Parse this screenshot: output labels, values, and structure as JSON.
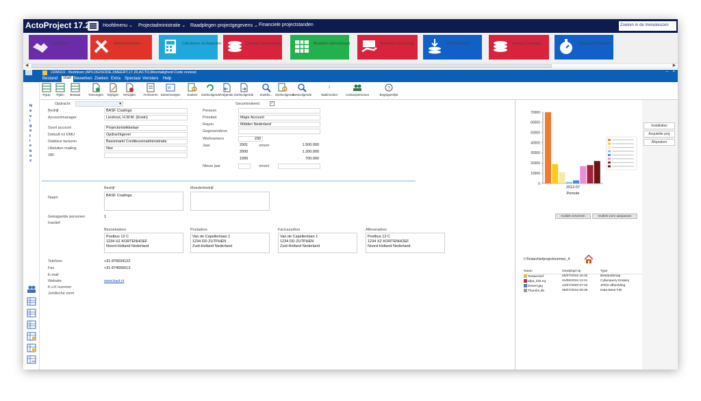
{
  "app": {
    "title": "ActoProject 17.20",
    "menu": [
      "Hoofdmenu",
      "Projectadministratie",
      "Raadplegen projectgegevens",
      "Financiele projectstanden"
    ],
    "menu_search": "Zoeken in de menukeuzen"
  },
  "tiles": [
    {
      "label": "Favorieten",
      "color": "#6a2ca8",
      "icon": "handshake-icon"
    },
    {
      "label": "Middelenbeheer",
      "color": "#e2332a",
      "icon": "tools-icon"
    },
    {
      "label": "Calculeren en begroten",
      "color": "#1fa8dc",
      "icon": "calculator-icon"
    },
    {
      "label": "Inkopen (decentraal)",
      "color": "#d9223b",
      "icon": "coins-icon"
    },
    {
      "label": "Bestellen (decentraal)",
      "color": "#22b14c",
      "icon": "spreadsheet-icon"
    },
    {
      "label": "Bestellen (Centraal)",
      "color": "#d9223b",
      "icon": "cash-hand-icon"
    },
    {
      "label": "Offertebeheer",
      "color": "#1060c8",
      "icon": "download-coins-icon"
    },
    {
      "label": "Inkoop (Centraal)",
      "color": "#d9223b",
      "icon": "coins-icon"
    },
    {
      "label": "Projectadministratie",
      "color": "#1060c8",
      "icon": "stopwatch-icon"
    }
  ],
  "window": {
    "title": "CRM110 - Bedrijven (APLOGISODE,XMEERT,17.20,ACTO,Meertaligheid Code review)",
    "tabs": [
      "Bestand",
      "Start",
      "Bewerken",
      "Zoeken",
      "Extra",
      "Speciaal",
      "Vensters",
      "Help"
    ],
    "active_tab": "Start"
  },
  "ribbon": [
    "PgUp",
    "PgDn",
    "Bewaar",
    "Toevoegen",
    "Wijzigen",
    "Verwijder",
    "Archiveren",
    "Samenvoegen",
    "Zoeken",
    "Zoeken",
    "Zoekvolgende",
    "Volgende",
    "Zoekvolgende",
    "Zoekbo...",
    "Zoekbo...",
    "Zoekvolgende",
    "Taakmonitor",
    "Contactpersonen",
    "Begrippenlijst"
  ],
  "ribbon_short": {
    "b1": "PgUp",
    "b2": "PgDn",
    "b3": "Bewaar",
    "b4": "Toevoegen",
    "b5": "Wijzigen",
    "b6": "Verwijder",
    "b7": "Archiveren",
    "b8": "Samenvoegen",
    "b9": "Zoeken",
    "b10": "Zoekvolgende",
    "b11": "Volgende",
    "b12": "Zoekvolgende",
    "b13": "Zoekbo...",
    "b14": "Zoekvolgende",
    "b15": "Zoekvolgende",
    "b16": "Taakmonitor",
    "b17": "Contactpersonen",
    "b18": "Begrippenlijst",
    "taak_count": "1"
  },
  "navigator": "Navigatiebox",
  "form": {
    "opdracht_label": "Opdracht",
    "gecontroleerd_label": "Gecontroleerd",
    "bedrijf_label": "Bedrijf",
    "bedrijf": "BASF Coatings",
    "accountmanager_label": "Accountmanager",
    "accountmanager": "Lieshout, H.W.M. (Erwin)",
    "soort_account_label": "Soort account",
    "soort_account": "Projectontwikkelaar",
    "default_rol_label": "Default rol DMU",
    "default_rol": "Opdrachtgever",
    "debiteur_label": "Debiteur facturen",
    "debiteur": "Basismarkt Crediteurenadministratie",
    "uitsluiten_label": "Uitsluiten mailing",
    "uitsluiten": "Nee",
    "sbi_label": "SBI",
    "persoon_label": "Persoon",
    "prioriteit_label": "Prioriteit",
    "prioriteit": "Major Account",
    "rayon_label": "Rayon",
    "rayon": "Midden Nederland",
    "gegevensbron_label": "Gegevensbron",
    "werknemers_label": "Werknemers",
    "werknemers": "230",
    "jaar_label": "Jaar",
    "omzet_label": "omzet",
    "jaren": [
      {
        "jaar": "2001",
        "omzet": "1.500.000"
      },
      {
        "jaar": "2000",
        "omzet": "1.200.000"
      },
      {
        "jaar": "1999",
        "omzet": "700.000"
      }
    ],
    "nieuw_jaar_label": "Nieuw jaar",
    "naam_label": "Naam",
    "bedrijf_header": "Bedrijf",
    "naam": "BASF Coatings",
    "moederbedrijf_header": "Moederbedrijf",
    "gekoppelde_label": "Gekoppelde personen",
    "gekoppelde": "1",
    "inactief_label": "Inactief",
    "addresses": [
      {
        "header": "Bezoekadres",
        "text": "Postbus 12 C\n1234 XZ KORTENHOEF\nNoord-Holland Nederland"
      },
      {
        "header": "Postadres",
        "text": "Van de Capellenlaan 1\n1234 DD ZUTPHEN\nZuid-Holland Nederland"
      },
      {
        "header": "Factuuradres",
        "text": "Van de Capellenlaan 1\n1234 DD ZUTPHEN\nZuid-Holland Nederland"
      },
      {
        "header": "Afleveradres",
        "text": "Postbus 12 C\n1234 XZ KORTENHOEF\nNoord-Holland Nederland"
      }
    ],
    "telefoon_label": "Telefoon",
    "telefoon": "+31 876694122",
    "fax_label": "Fax",
    "fax": "+31 874556613",
    "email_label": "E-mail",
    "website_label": "Website",
    "website": "www.basf.nl",
    "kvk_label": "K.v.K nummer",
    "juridische_label": "Juridische vorm"
  },
  "chart_data": {
    "type": "bar",
    "categories": [
      "2012-07"
    ],
    "xlabel": "Periode",
    "ylim": [
      0,
      70000
    ],
    "yticks": [
      0,
      10000,
      20000,
      30000,
      40000,
      50000,
      60000,
      70000
    ],
    "series": [
      {
        "values": [
          70000
        ],
        "color": "#f07a2e"
      },
      {
        "values": [
          19000
        ],
        "color": "#f5cc1e"
      },
      {
        "values": [
          11000
        ],
        "color": "#f5e9a8"
      },
      {
        "values": [
          1500
        ],
        "color": "#7fc7e6"
      },
      {
        "values": [
          3000
        ],
        "color": "#4a88d8"
      },
      {
        "values": [
          17000
        ],
        "color": "#e98ed9"
      },
      {
        "values": [
          18000
        ],
        "color": "#a0233a"
      },
      {
        "values": [
          22000
        ],
        "color": "#6b1414"
      }
    ],
    "legend": "right"
  },
  "chart_buttons": {
    "refresh": "Grafiek verversen",
    "adjust": "Grafiek vorm aanpassen"
  },
  "files": {
    "path": "I:\\Testarchiefprojectnummer_4",
    "headers": {
      "name": "Naam",
      "modified": "Gewijzigd op",
      "type": "Type"
    },
    "rows": [
      {
        "name": "Testarchief",
        "modified": "05/07/2016 15:32",
        "type": "Bestandsmap",
        "color": "#e8b84a"
      },
      {
        "name": "afpa_bil2.eq",
        "modified": "01/06/2016 13:41",
        "type": "Cyberquery Enquiry",
        "color": "#c8203a"
      },
      {
        "name": "Desert.jpg",
        "modified": "14/07/2009 07:32",
        "type": "JPEG-afbeelding",
        "color": "#3f7fc0"
      },
      {
        "name": "Thumbs.db",
        "modified": "05/07/2016 09:39",
        "type": "Data Base File",
        "color": "#9a9a9a"
      }
    ]
  },
  "actions": [
    "Installaties",
    "Acquisitie proj",
    "Afspraken"
  ]
}
